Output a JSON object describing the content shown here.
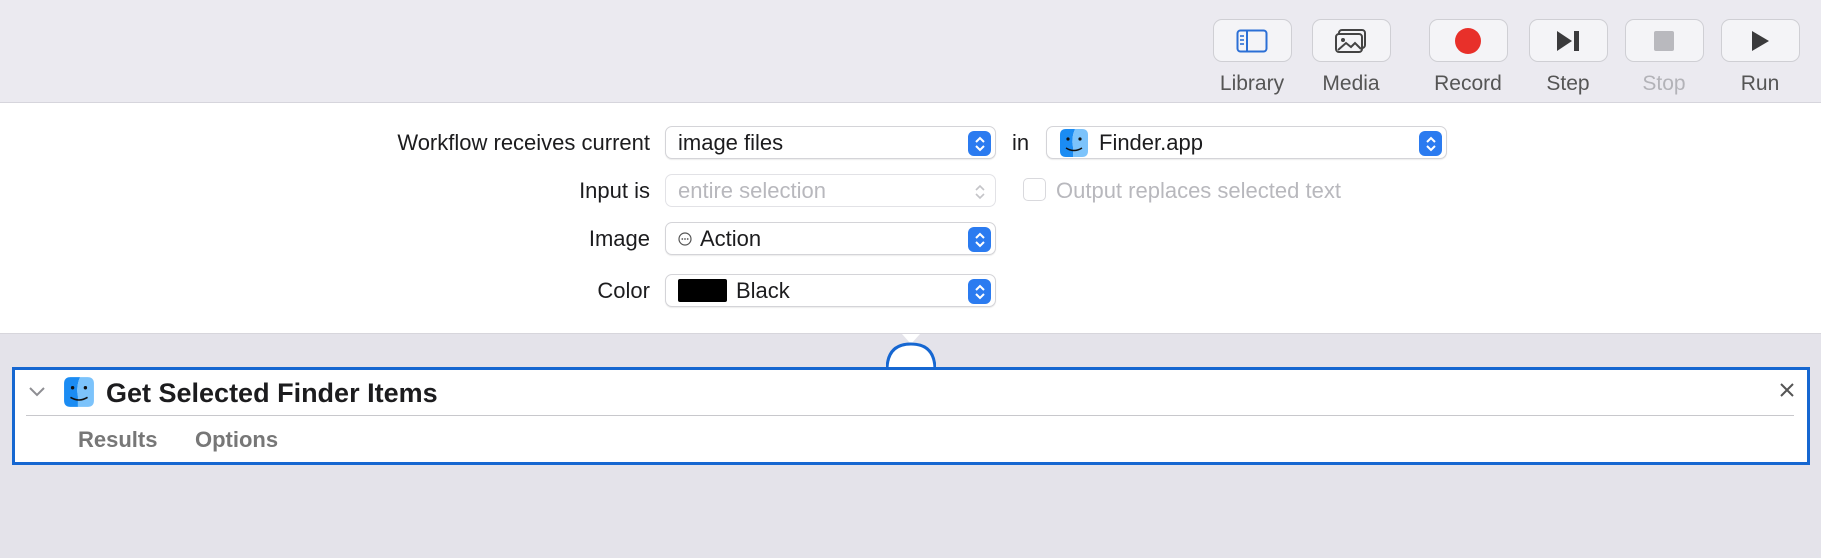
{
  "toolbar": {
    "library_label": "Library",
    "media_label": "Media",
    "record_label": "Record",
    "step_label": "Step",
    "stop_label": "Stop",
    "run_label": "Run"
  },
  "workflow": {
    "receives_label": "Workflow receives current",
    "receives_value": "image files",
    "in_label": "in",
    "app_value": "Finder.app",
    "input_label": "Input is",
    "input_value": "entire selection",
    "output_replaces_label": "Output replaces selected text",
    "output_replaces_checked": false,
    "image_label": "Image",
    "image_value": "Action",
    "color_label": "Color",
    "color_value": "Black",
    "color_swatch": "#000000"
  },
  "action": {
    "title": "Get Selected Finder Items",
    "tabs": [
      "Results",
      "Options"
    ]
  },
  "colors": {
    "accent": "#2b7bf0",
    "record": "#e8302a",
    "selection_border": "#1667d1"
  }
}
